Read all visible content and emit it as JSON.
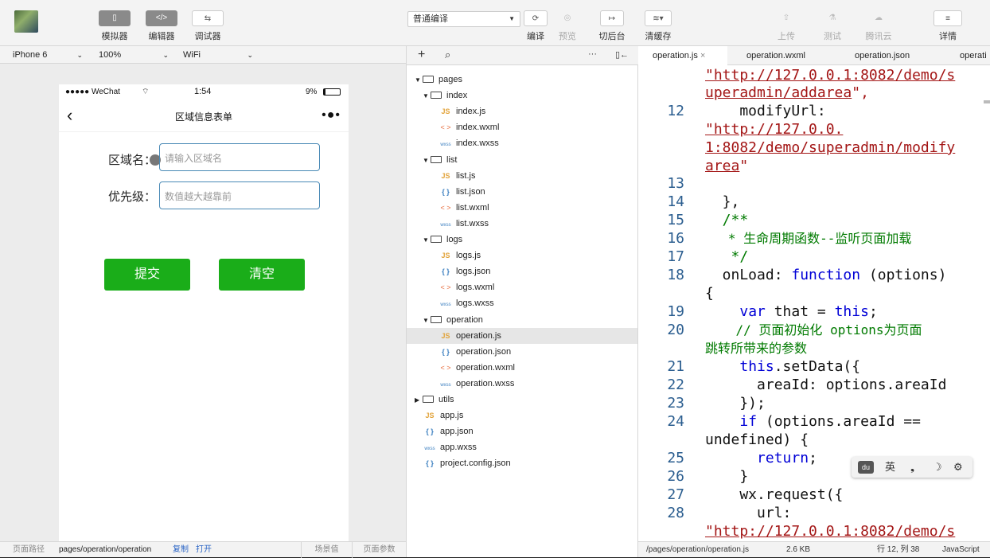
{
  "toolbar": {
    "simulator": "模拟器",
    "editor": "编辑器",
    "debugger": "调试器",
    "compile_mode": "普通编译",
    "compile": "编译",
    "preview": "预览",
    "backend": "切后台",
    "clear_cache": "清缓存",
    "upload": "上传",
    "test": "测试",
    "cloud": "腾讯云",
    "details": "详情"
  },
  "device": {
    "model": "iPhone 6",
    "zoom": "100%",
    "network": "WiFi"
  },
  "phone": {
    "signal": "●●●●● WeChat",
    "time": "1:54",
    "battery": "9%",
    "title": "区域信息表单",
    "form": {
      "area_label": "区域名：",
      "area_placeholder": "请输入区域名",
      "priority_label": "优先级：",
      "priority_placeholder": "数值越大越靠前"
    },
    "submit": "提交",
    "clear": "清空"
  },
  "pathbar": {
    "label": "页面路径",
    "path": "pages/operation/operation",
    "copy": "复制",
    "open": "打开",
    "scene": "场景值",
    "params": "页面参数"
  },
  "files": {
    "more": "···",
    "tree": [
      {
        "name": "pages",
        "type": "folder",
        "open": true
      },
      {
        "name": "index",
        "type": "folder",
        "open": true
      },
      {
        "name": "index.js",
        "type": "js"
      },
      {
        "name": "index.wxml",
        "type": "wxml"
      },
      {
        "name": "index.wxss",
        "type": "wxss"
      },
      {
        "name": "list",
        "type": "folder",
        "open": true
      },
      {
        "name": "list.js",
        "type": "js"
      },
      {
        "name": "list.json",
        "type": "json"
      },
      {
        "name": "list.wxml",
        "type": "wxml"
      },
      {
        "name": "list.wxss",
        "type": "wxss"
      },
      {
        "name": "logs",
        "type": "folder",
        "open": true
      },
      {
        "name": "logs.js",
        "type": "js"
      },
      {
        "name": "logs.json",
        "type": "json"
      },
      {
        "name": "logs.wxml",
        "type": "wxml"
      },
      {
        "name": "logs.wxss",
        "type": "wxss"
      },
      {
        "name": "operation",
        "type": "folder",
        "open": true
      },
      {
        "name": "operation.js",
        "type": "js",
        "selected": true
      },
      {
        "name": "operation.json",
        "type": "json"
      },
      {
        "name": "operation.wxml",
        "type": "wxml"
      },
      {
        "name": "operation.wxss",
        "type": "wxss"
      },
      {
        "name": "utils",
        "type": "folder",
        "open": false
      },
      {
        "name": "app.js",
        "type": "js"
      },
      {
        "name": "app.json",
        "type": "json"
      },
      {
        "name": "app.wxss",
        "type": "wxss"
      },
      {
        "name": "project.config.json",
        "type": "json"
      }
    ]
  },
  "tabs": [
    "operation.js",
    "operation.wxml",
    "operation.json",
    "operati"
  ],
  "icon_labels": {
    "js": "JS",
    "json": "{ }",
    "wxml": "< >",
    "wxss": "wxss",
    "close": "×"
  },
  "code": {
    "l0": "\"http://127.0.0.1:8082/demo/s",
    "l1": "uperadmin/addarea",
    "l1b": "\",",
    "n12": "12",
    "l2": "    modifyUrl:",
    "l3": "\"http://127.0.0.",
    "l4": "1:8082/demo/superadmin/modify",
    "l5": "area",
    "l5b": "\"",
    "n13": "13",
    "n14": "14",
    "l14": "  },",
    "n15": "15",
    "l15": "  /**",
    "n16": "16",
    "l16": "   * 生命周期函数--监听页面加载",
    "n17": "17",
    "l17": "   */",
    "n18": "18",
    "l18a": "  onLoad: ",
    "l18b": "function",
    "l18c": " (options)",
    "l18d": "{",
    "n19": "19",
    "l19a": "    ",
    "l19b": "var",
    "l19c": " that = ",
    "l19d": "this",
    "l19e": ";",
    "n20": "20",
    "l20": "    // 页面初始化 options为页面",
    "l20b": "跳转所带来的参数",
    "n21": "21",
    "l21a": "    ",
    "l21b": "this",
    "l21c": ".setData({",
    "n22": "22",
    "l22": "      areaId: options.areaId",
    "n23": "23",
    "l23": "    });",
    "n24": "24",
    "l24a": "    ",
    "l24b": "if",
    "l24c": " (options.areaId ==",
    "l24d": "undefined) {",
    "n25": "25",
    "l25a": "      ",
    "l25b": "return",
    "l25c": ";",
    "n26": "26",
    "l26": "    }",
    "n27": "27",
    "l27": "    wx.request({",
    "n28": "28",
    "l28": "      url:",
    "l29": "\"http://127.0.0.1:8082/demo/s"
  },
  "statusbar": {
    "path": "/pages/operation/operation.js",
    "size": "2.6 KB",
    "pos": "行 12, 列 38",
    "lang": "JavaScript"
  },
  "ime": {
    "label": "英"
  }
}
